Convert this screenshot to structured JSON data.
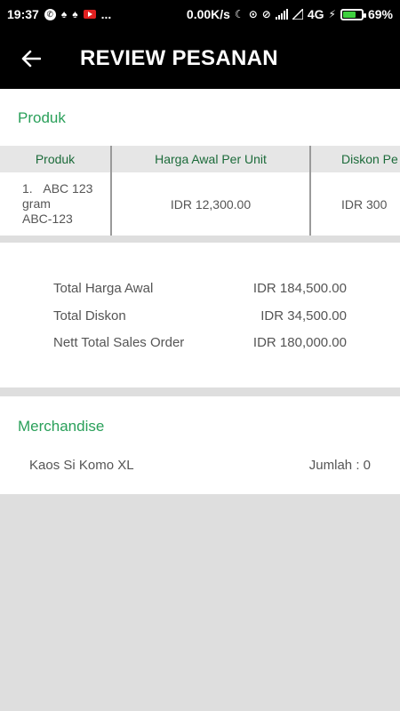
{
  "status_bar": {
    "time": "19:37",
    "more": "...",
    "net_speed": "0.00K/s",
    "network": "4G",
    "battery_percent": "69%",
    "battery_level": 0.69,
    "icons": [
      "whatsapp-icon",
      "app-icon",
      "app-icon",
      "youtube-icon",
      "moon-icon",
      "headset-icon",
      "vibrate-off-icon",
      "signal-icon",
      "signal-icon",
      "charging-icon",
      "battery-icon"
    ]
  },
  "header": {
    "title": "REVIEW PESANAN",
    "back_icon": "arrow-left-icon"
  },
  "produk": {
    "section_title": "Produk",
    "columns": [
      "Produk",
      "Harga Awal Per Unit",
      "Diskon Pe"
    ],
    "rows": [
      {
        "index": "1.",
        "name": "ABC 123",
        "unit": "gram",
        "code": "ABC-123",
        "price": "IDR 12,300.00",
        "discount": "IDR 300"
      }
    ]
  },
  "summary": {
    "total_harga_awal_label": "Total Harga Awal",
    "total_harga_awal_value": "IDR 184,500.00",
    "total_diskon_label": "Total Diskon",
    "total_diskon_value": "IDR 34,500.00",
    "nett_total_label": "Nett Total Sales Order",
    "nett_total_value": "IDR 180,000.00"
  },
  "merchandise": {
    "section_title": "Merchandise",
    "items": [
      {
        "name": "Kaos Si Komo XL",
        "qty": "Jumlah : 0"
      }
    ]
  },
  "colors": {
    "accent": "#2aa05a",
    "header_bg": "#000000",
    "page_bg": "#dedede"
  }
}
